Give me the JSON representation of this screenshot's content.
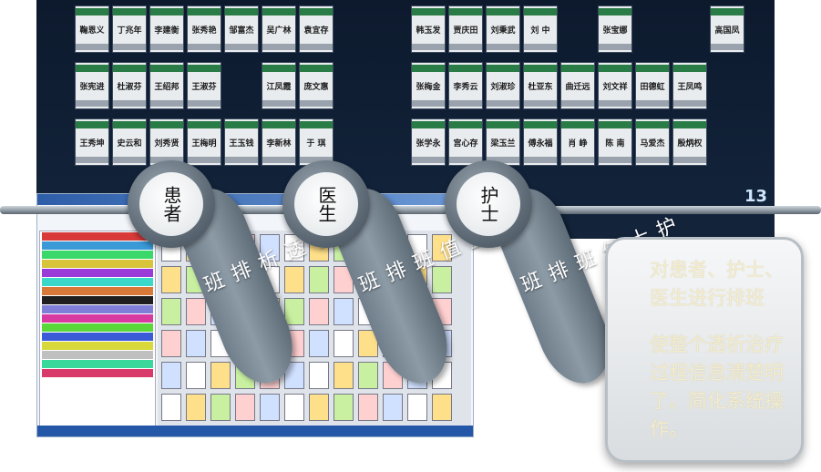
{
  "tags": [
    {
      "disc": "患者",
      "tail": "患者透析排班"
    },
    {
      "disc": "医生",
      "tail": "医生值班排班"
    },
    {
      "disc": "护士",
      "tail": "护士值班排班"
    }
  ],
  "card": {
    "line1": "对患者、护士、医生进行排班",
    "line2": "使整个透析治疗过程信息清楚明了。简化系统操作。"
  },
  "screen": {
    "row1": [
      "鞠恩义",
      "丁兆年",
      "李建衡",
      "张秀艳",
      "邹富杰",
      "吴广林",
      "袁宜存",
      "",
      "",
      "韩玉发",
      "贾庆田",
      "刘秉武",
      "刘 中",
      "",
      "张宝娜",
      "",
      "",
      "高国凤"
    ],
    "row2": [
      "张宪进",
      "杜淑芬",
      "王绍邦",
      "王淑芬",
      "",
      "江凤霞",
      "庞文惠",
      "",
      "",
      "张梅金",
      "李秀云",
      "刘淑珍",
      "杜亚东",
      "曲迁远",
      "刘文祥",
      "田德虹",
      "王凤鸣"
    ],
    "row3": [
      "王秀坤",
      "史云和",
      "刘秀贤",
      "王梅明",
      "王玉钱",
      "李新林",
      "于 琪",
      "",
      "",
      "张学永",
      "宫心存",
      "梁玉兰",
      "傅永福",
      "肖 峥",
      "陈 南",
      "马爱杰",
      "殷炳权"
    ],
    "date_fragment": "13"
  },
  "colors": {
    "card_text": "#f3eccd",
    "tail_gray": "#7a8894"
  }
}
